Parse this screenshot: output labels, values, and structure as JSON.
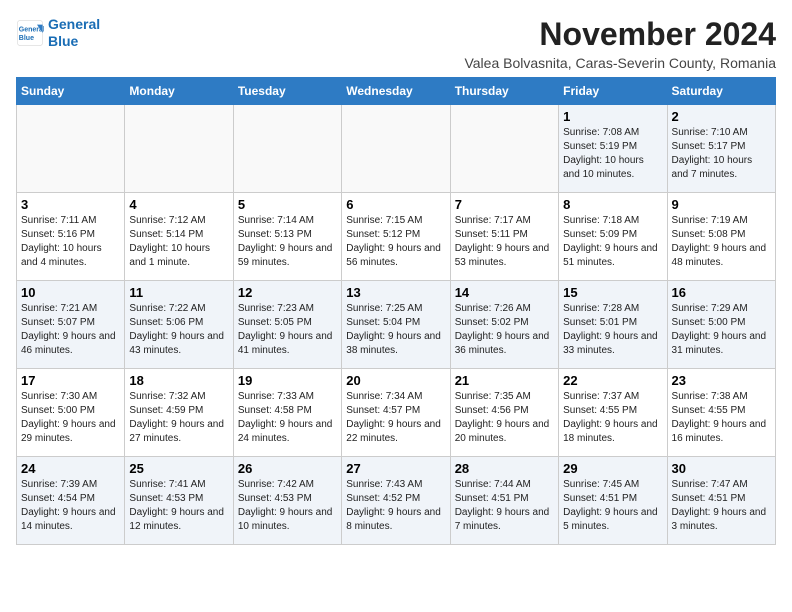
{
  "logo": {
    "line1": "General",
    "line2": "Blue"
  },
  "title": "November 2024",
  "subtitle": "Valea Bolvasnita, Caras-Severin County, Romania",
  "weekdays": [
    "Sunday",
    "Monday",
    "Tuesday",
    "Wednesday",
    "Thursday",
    "Friday",
    "Saturday"
  ],
  "weeks": [
    [
      {
        "day": "",
        "info": ""
      },
      {
        "day": "",
        "info": ""
      },
      {
        "day": "",
        "info": ""
      },
      {
        "day": "",
        "info": ""
      },
      {
        "day": "",
        "info": ""
      },
      {
        "day": "1",
        "info": "Sunrise: 7:08 AM\nSunset: 5:19 PM\nDaylight: 10 hours and 10 minutes."
      },
      {
        "day": "2",
        "info": "Sunrise: 7:10 AM\nSunset: 5:17 PM\nDaylight: 10 hours and 7 minutes."
      }
    ],
    [
      {
        "day": "3",
        "info": "Sunrise: 7:11 AM\nSunset: 5:16 PM\nDaylight: 10 hours and 4 minutes."
      },
      {
        "day": "4",
        "info": "Sunrise: 7:12 AM\nSunset: 5:14 PM\nDaylight: 10 hours and 1 minute."
      },
      {
        "day": "5",
        "info": "Sunrise: 7:14 AM\nSunset: 5:13 PM\nDaylight: 9 hours and 59 minutes."
      },
      {
        "day": "6",
        "info": "Sunrise: 7:15 AM\nSunset: 5:12 PM\nDaylight: 9 hours and 56 minutes."
      },
      {
        "day": "7",
        "info": "Sunrise: 7:17 AM\nSunset: 5:11 PM\nDaylight: 9 hours and 53 minutes."
      },
      {
        "day": "8",
        "info": "Sunrise: 7:18 AM\nSunset: 5:09 PM\nDaylight: 9 hours and 51 minutes."
      },
      {
        "day": "9",
        "info": "Sunrise: 7:19 AM\nSunset: 5:08 PM\nDaylight: 9 hours and 48 minutes."
      }
    ],
    [
      {
        "day": "10",
        "info": "Sunrise: 7:21 AM\nSunset: 5:07 PM\nDaylight: 9 hours and 46 minutes."
      },
      {
        "day": "11",
        "info": "Sunrise: 7:22 AM\nSunset: 5:06 PM\nDaylight: 9 hours and 43 minutes."
      },
      {
        "day": "12",
        "info": "Sunrise: 7:23 AM\nSunset: 5:05 PM\nDaylight: 9 hours and 41 minutes."
      },
      {
        "day": "13",
        "info": "Sunrise: 7:25 AM\nSunset: 5:04 PM\nDaylight: 9 hours and 38 minutes."
      },
      {
        "day": "14",
        "info": "Sunrise: 7:26 AM\nSunset: 5:02 PM\nDaylight: 9 hours and 36 minutes."
      },
      {
        "day": "15",
        "info": "Sunrise: 7:28 AM\nSunset: 5:01 PM\nDaylight: 9 hours and 33 minutes."
      },
      {
        "day": "16",
        "info": "Sunrise: 7:29 AM\nSunset: 5:00 PM\nDaylight: 9 hours and 31 minutes."
      }
    ],
    [
      {
        "day": "17",
        "info": "Sunrise: 7:30 AM\nSunset: 5:00 PM\nDaylight: 9 hours and 29 minutes."
      },
      {
        "day": "18",
        "info": "Sunrise: 7:32 AM\nSunset: 4:59 PM\nDaylight: 9 hours and 27 minutes."
      },
      {
        "day": "19",
        "info": "Sunrise: 7:33 AM\nSunset: 4:58 PM\nDaylight: 9 hours and 24 minutes."
      },
      {
        "day": "20",
        "info": "Sunrise: 7:34 AM\nSunset: 4:57 PM\nDaylight: 9 hours and 22 minutes."
      },
      {
        "day": "21",
        "info": "Sunrise: 7:35 AM\nSunset: 4:56 PM\nDaylight: 9 hours and 20 minutes."
      },
      {
        "day": "22",
        "info": "Sunrise: 7:37 AM\nSunset: 4:55 PM\nDaylight: 9 hours and 18 minutes."
      },
      {
        "day": "23",
        "info": "Sunrise: 7:38 AM\nSunset: 4:55 PM\nDaylight: 9 hours and 16 minutes."
      }
    ],
    [
      {
        "day": "24",
        "info": "Sunrise: 7:39 AM\nSunset: 4:54 PM\nDaylight: 9 hours and 14 minutes."
      },
      {
        "day": "25",
        "info": "Sunrise: 7:41 AM\nSunset: 4:53 PM\nDaylight: 9 hours and 12 minutes."
      },
      {
        "day": "26",
        "info": "Sunrise: 7:42 AM\nSunset: 4:53 PM\nDaylight: 9 hours and 10 minutes."
      },
      {
        "day": "27",
        "info": "Sunrise: 7:43 AM\nSunset: 4:52 PM\nDaylight: 9 hours and 8 minutes."
      },
      {
        "day": "28",
        "info": "Sunrise: 7:44 AM\nSunset: 4:51 PM\nDaylight: 9 hours and 7 minutes."
      },
      {
        "day": "29",
        "info": "Sunrise: 7:45 AM\nSunset: 4:51 PM\nDaylight: 9 hours and 5 minutes."
      },
      {
        "day": "30",
        "info": "Sunrise: 7:47 AM\nSunset: 4:51 PM\nDaylight: 9 hours and 3 minutes."
      }
    ]
  ]
}
